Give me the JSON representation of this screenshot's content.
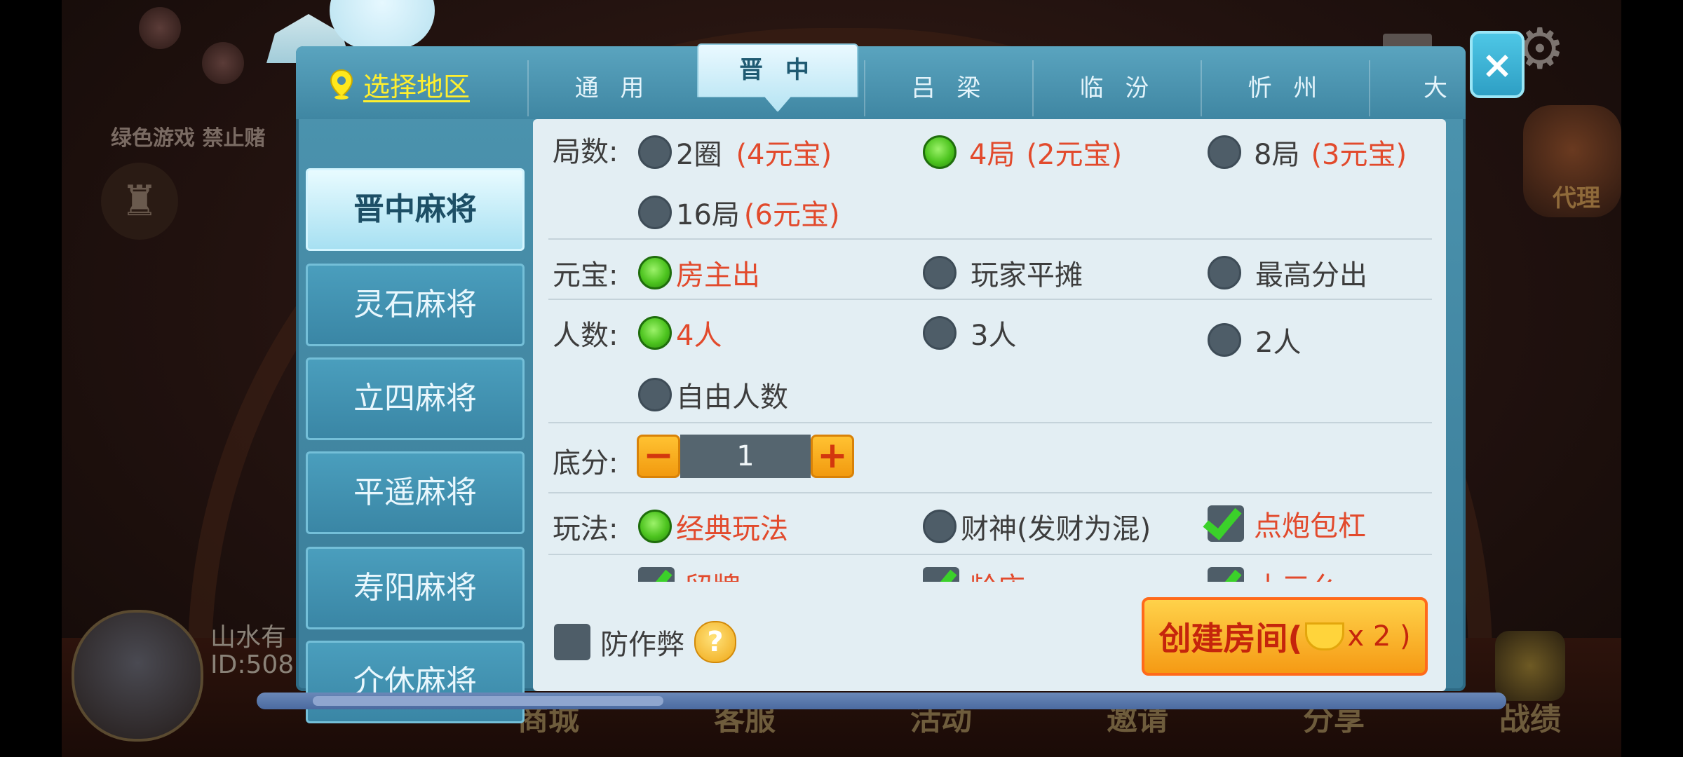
{
  "background": {
    "green_game_notice": "绿色游戏 禁止赌",
    "player_name": "山水有",
    "player_id": "ID:508",
    "agent_label": "代理",
    "bottom_nav": [
      "商城",
      "客服",
      "活动",
      "邀请",
      "分享",
      "战绩"
    ]
  },
  "header": {
    "region_label": "选择地区",
    "tabs": [
      {
        "label": "通 用",
        "active": false
      },
      {
        "label": "晋 中",
        "active": true
      },
      {
        "label": "吕 梁",
        "active": false
      },
      {
        "label": "临 汾",
        "active": false
      },
      {
        "label": "忻 州",
        "active": false
      },
      {
        "label": "大",
        "active": false
      }
    ],
    "close_symbol": "×"
  },
  "sidebar": {
    "items": [
      {
        "label": "晋中麻将",
        "active": true
      },
      {
        "label": "灵石麻将",
        "active": false
      },
      {
        "label": "立四麻将",
        "active": false
      },
      {
        "label": "平遥麻将",
        "active": false
      },
      {
        "label": "寿阳麻将",
        "active": false
      },
      {
        "label": "介休麻将",
        "active": false
      }
    ]
  },
  "options": {
    "rounds": {
      "label": "局数:",
      "choices": [
        {
          "name": "2圈",
          "cost": "(4元宝)",
          "selected": false
        },
        {
          "name": "4局",
          "cost": "(2元宝)",
          "selected": true
        },
        {
          "name": "8局",
          "cost": "(3元宝)",
          "selected": false
        },
        {
          "name": "16局",
          "cost": "(6元宝)",
          "selected": false
        }
      ]
    },
    "ingot": {
      "label": "元宝:",
      "choices": [
        {
          "name": "房主出",
          "selected": true
        },
        {
          "name": "玩家平摊",
          "selected": false
        },
        {
          "name": "最高分出",
          "selected": false
        }
      ]
    },
    "players": {
      "label": "人数:",
      "choices": [
        {
          "name": "4人",
          "selected": true
        },
        {
          "name": "3人",
          "selected": false
        },
        {
          "name": "2人",
          "selected": false
        },
        {
          "name": "自由人数",
          "selected": false
        }
      ]
    },
    "base_score": {
      "label": "底分:",
      "value": "1",
      "minus": "−",
      "plus": "+"
    },
    "play_style": {
      "label": "玩法:",
      "radio_choices": [
        {
          "name": "经典玩法",
          "selected": true
        },
        {
          "name": "财神(发财为混)",
          "selected": false
        }
      ],
      "checkbox_choices": [
        {
          "name": "点炮包杠",
          "checked": true
        },
        {
          "name": "留牌",
          "checked": true
        },
        {
          "name": "龄庄",
          "checked": true
        },
        {
          "name": "十三幺",
          "checked": true
        }
      ]
    }
  },
  "footer": {
    "anticheat_label": "防作弊",
    "anticheat_checked": false,
    "help_symbol": "?",
    "create_label": "创建房间(",
    "create_cost": "x 2 )"
  },
  "colors": {
    "accent_red": "#e24a2c",
    "region_yellow": "#ffef2e",
    "radio_on": "#4dc41f",
    "button_orange": "#f59a14"
  }
}
